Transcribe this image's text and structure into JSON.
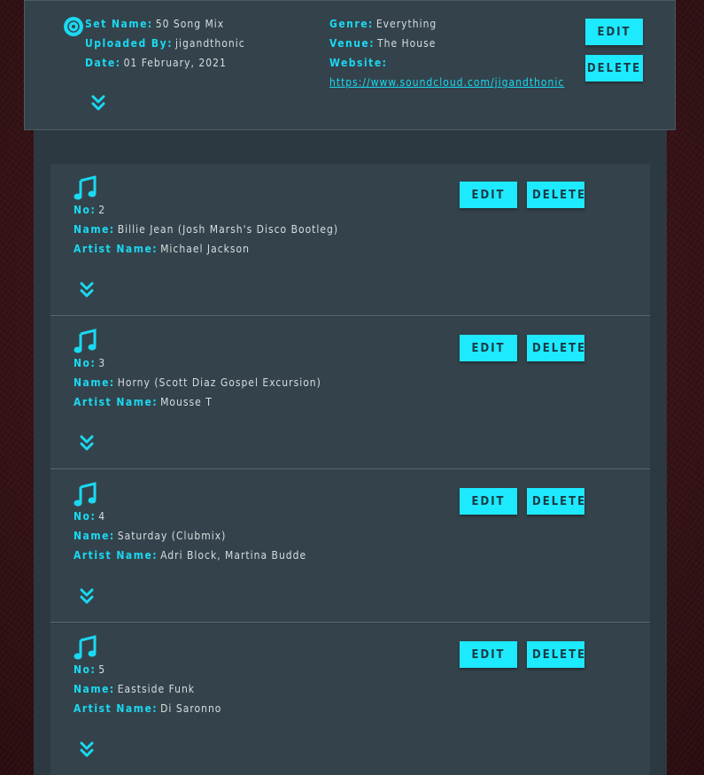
{
  "set": {
    "icon": "vinyl-disc-icon",
    "set_name_label": "Set Name:",
    "set_name": "50 Song Mix",
    "uploaded_by_label": "Uploaded By:",
    "uploaded_by": "jigandthonic",
    "date_label": "Date:",
    "date": "01 February, 2021",
    "genre_label": "Genre:",
    "genre": "Everything",
    "venue_label": "Venue:",
    "venue": "The House",
    "website_label": "Website:",
    "website": "https://www.soundcloud.com/jigandthonic",
    "edit_label": "EDIT",
    "delete_label": "DELETE"
  },
  "songs": [
    {
      "no_label": "No:",
      "no": "2",
      "name_label": "Name:",
      "name": "Billie Jean (Josh Marsh's Disco Bootleg)",
      "artist_label": "Artist Name:",
      "artist": "Michael Jackson",
      "edit_label": "EDIT",
      "delete_label": "DELETE"
    },
    {
      "no_label": "No:",
      "no": "3",
      "name_label": "Name:",
      "name": "Horny (Scott Diaz Gospel Excursion)",
      "artist_label": "Artist Name:",
      "artist": "Mousse T",
      "edit_label": "EDIT",
      "delete_label": "DELETE"
    },
    {
      "no_label": "No:",
      "no": "4",
      "name_label": "Name:",
      "name": "Saturday (Clubmix)",
      "artist_label": "Artist Name:",
      "artist": "Adri Block, Martina Budde",
      "edit_label": "EDIT",
      "delete_label": "DELETE"
    },
    {
      "no_label": "No:",
      "no": "5",
      "name_label": "Name:",
      "name": "Eastside Funk",
      "artist_label": "Artist Name:",
      "artist": "Di Saronno",
      "edit_label": "EDIT",
      "delete_label": "DELETE"
    }
  ],
  "colors": {
    "accent": "#1de9ff",
    "card": "#34434b",
    "panel": "#2d3940",
    "background": "#3a1519"
  }
}
